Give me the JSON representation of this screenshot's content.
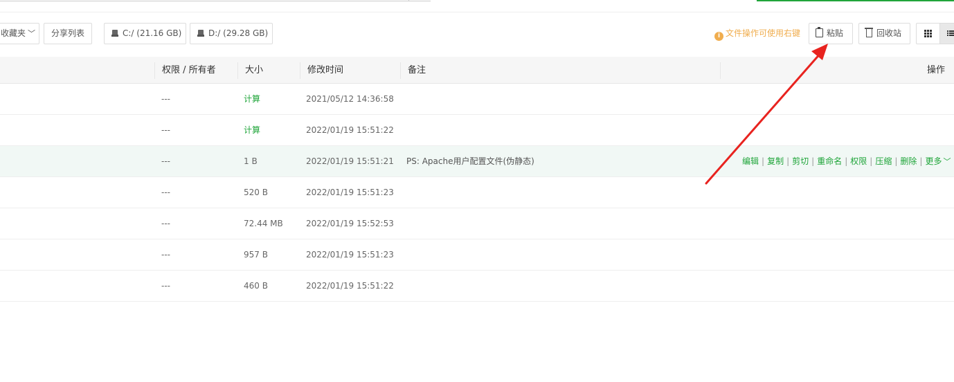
{
  "toolbar": {
    "favorites_label": "收藏夹",
    "share_list_label": "分享列表",
    "disk_c_label": "C:/ (21.16 GB)",
    "disk_d_label": "D:/ (29.28 GB)",
    "tip_text": "文件操作可使用右键",
    "paste_label": "粘贴",
    "recycle_label": "回收站"
  },
  "table": {
    "headers": {
      "perm": "权限 / 所有者",
      "size": "大小",
      "mtime": "修改时间",
      "note": "备注",
      "ops": "操作"
    },
    "rows": [
      {
        "perm": "---",
        "size": "计算",
        "mtime": "2021/05/12 14:36:58",
        "note": ""
      },
      {
        "perm": "---",
        "size": "计算",
        "mtime": "2022/01/19 15:51:22",
        "note": ""
      },
      {
        "perm": "---",
        "size": "1 B",
        "mtime": "2022/01/19 15:51:21",
        "note": "PS: Apache用户配置文件(伪静态)"
      },
      {
        "perm": "---",
        "size": "520 B",
        "mtime": "2022/01/19 15:51:23",
        "note": ""
      },
      {
        "perm": "---",
        "size": "72.44 MB",
        "mtime": "2022/01/19 15:52:53",
        "note": ""
      },
      {
        "perm": "---",
        "size": "957 B",
        "mtime": "2022/01/19 15:51:23",
        "note": ""
      },
      {
        "perm": "---",
        "size": "460 B",
        "mtime": "2022/01/19 15:51:22",
        "note": ""
      }
    ],
    "row_actions": [
      "编辑",
      "复制",
      "剪切",
      "重命名",
      "权限",
      "压缩",
      "删除",
      "更多"
    ]
  },
  "colors": {
    "accent": "#20a53a",
    "tip": "#f0ad4e",
    "arrow": "#e8231f",
    "highlight_row": "#f1f8f5"
  },
  "icons": [
    "chevron-down-icon",
    "disk-icon",
    "info-icon",
    "clipboard-icon",
    "trash-icon",
    "grid-view-icon",
    "list-view-icon"
  ]
}
